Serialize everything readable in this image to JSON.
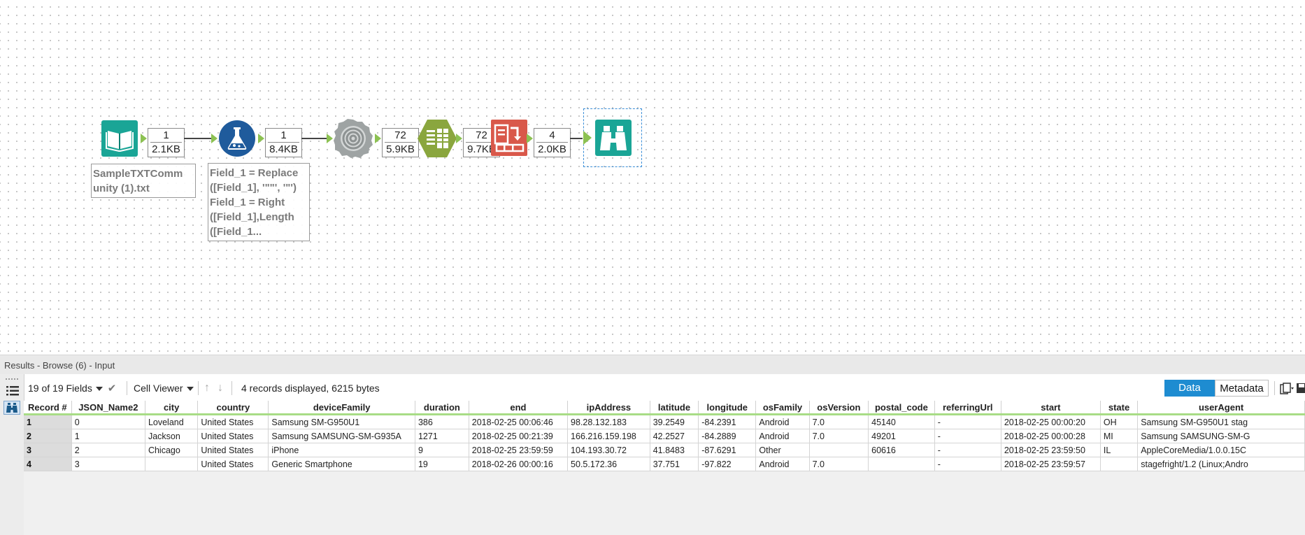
{
  "workflow": {
    "input_file_label": "SampleTXTComm\nunity (1).txt",
    "formula_annotation": "Field_1 = Replace\n([Field_1], '\"\"', '\"')\nField_1 = Right\n([Field_1],Length\n([Field_1...",
    "connections": [
      {
        "records": "1",
        "size": "2.1KB"
      },
      {
        "records": "1",
        "size": "8.4KB"
      },
      {
        "records": "72",
        "size": "5.9KB"
      },
      {
        "records": "72",
        "size": "9.7KB"
      },
      {
        "records": "4",
        "size": "2.0KB"
      }
    ],
    "tools": [
      "input-data-icon",
      "formula-icon",
      "json-parse-icon",
      "text-to-columns-icon",
      "cross-tab-icon",
      "browse-icon"
    ]
  },
  "results": {
    "header": "Results - Browse (6) - Input",
    "fields_selector": "19 of 19 Fields",
    "viewer_selector": "Cell Viewer",
    "summary": "4 records displayed, 6215 bytes",
    "tab_data": "Data",
    "tab_metadata": "Metadata",
    "accent": "#1e8cd1",
    "columns": [
      "Record #",
      "JSON_Name2",
      "city",
      "country",
      "deviceFamily",
      "duration",
      "end",
      "ipAddress",
      "latitude",
      "longitude",
      "osFamily",
      "osVersion",
      "postal_code",
      "referringUrl",
      "start",
      "state",
      "userAgent"
    ],
    "rows": [
      [
        "1",
        "0",
        "Loveland",
        "United States",
        "Samsung SM-G950U1",
        "386",
        "2018-02-25 00:06:46",
        "98.28.132.183",
        "39.2549",
        "-84.2391",
        "Android",
        "7.0",
        "45140",
        "-",
        "2018-02-25 00:00:20",
        "OH",
        "Samsung SM-G950U1 stag"
      ],
      [
        "2",
        "1",
        "Jackson",
        "United States",
        "Samsung SAMSUNG-SM-G935A",
        "1271",
        "2018-02-25 00:21:39",
        "166.216.159.198",
        "42.2527",
        "-84.2889",
        "Android",
        "7.0",
        "49201",
        "-",
        "2018-02-25 00:00:28",
        "MI",
        "Samsung SAMSUNG-SM-G"
      ],
      [
        "3",
        "2",
        "Chicago",
        "United States",
        "iPhone",
        "9",
        "2018-02-25 23:59:59",
        "104.193.30.72",
        "41.8483",
        "-87.6291",
        "Other",
        "",
        "60616",
        "-",
        "2018-02-25 23:59:50",
        "IL",
        "AppleCoreMedia/1.0.0.15C"
      ],
      [
        "4",
        "3",
        "",
        "United States",
        "Generic Smartphone",
        "19",
        "2018-02-26 00:00:16",
        "50.5.172.36",
        "37.751",
        "-97.822",
        "Android",
        "7.0",
        "",
        "-",
        "2018-02-25 23:59:57",
        "",
        "stagefright/1.2 (Linux;Andro"
      ]
    ]
  }
}
